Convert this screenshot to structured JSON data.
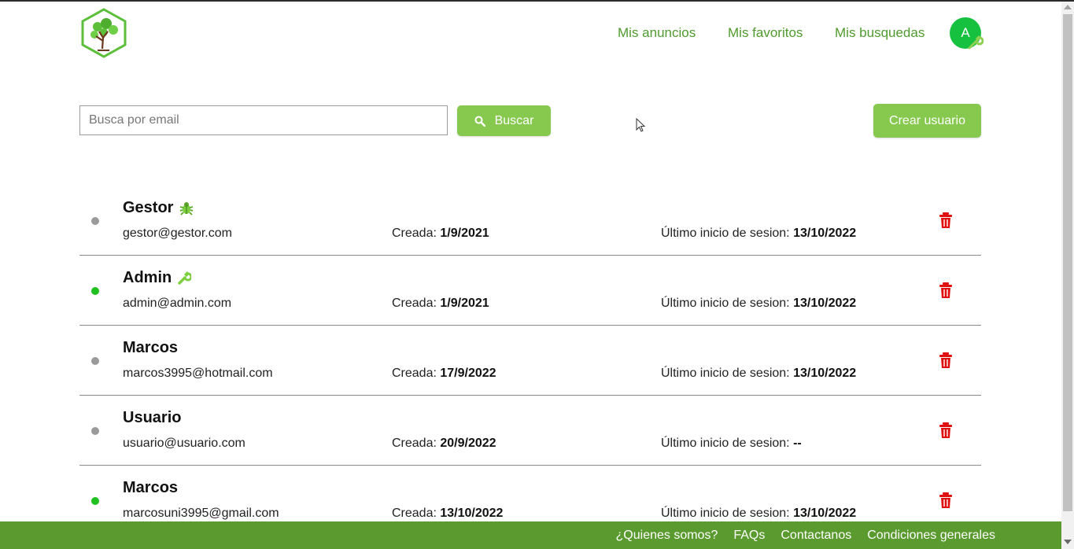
{
  "header": {
    "logo_icon": "tree-hexagon-logo",
    "nav": [
      {
        "label": "Mis anuncios"
      },
      {
        "label": "Mis favoritos"
      },
      {
        "label": "Mis busquedas"
      }
    ],
    "avatar_initial": "A",
    "avatar_badge_icon": "wrench-icon"
  },
  "toolbar": {
    "search_placeholder": "Busca por email",
    "search_value": "",
    "search_button": "Buscar",
    "search_icon": "search-icon",
    "create_button": "Crear usuario"
  },
  "labels": {
    "created": "Creada:",
    "last_login": "Último inicio de sesion:"
  },
  "users": [
    {
      "name": "Gestor",
      "role_icon": "bug-icon",
      "status": "offline",
      "email": "gestor@gestor.com",
      "created": "1/9/2021",
      "last_login": "13/10/2022"
    },
    {
      "name": "Admin",
      "role_icon": "wrench-icon",
      "status": "online",
      "email": "admin@admin.com",
      "created": "1/9/2021",
      "last_login": "13/10/2022"
    },
    {
      "name": "Marcos",
      "role_icon": "",
      "status": "offline",
      "email": "marcos3995@hotmail.com",
      "created": "17/9/2022",
      "last_login": "13/10/2022"
    },
    {
      "name": "Usuario",
      "role_icon": "",
      "status": "offline",
      "email": "usuario@usuario.com",
      "created": "20/9/2022",
      "last_login": "--"
    },
    {
      "name": "Marcos",
      "role_icon": "",
      "status": "online",
      "email": "marcosuni3995@gmail.com",
      "created": "13/10/2022",
      "last_login": "13/10/2022"
    }
  ],
  "footer": {
    "links": [
      "¿Quienes somos?",
      "FAQs",
      "Contactanos",
      "Condiciones generales"
    ]
  },
  "colors": {
    "accent": "#86c94e",
    "nav_text": "#4f9a2e",
    "footer_bg": "#5a9a2e",
    "avatar": "#16c13f",
    "online": "#1fc01f",
    "offline": "#9a9a9a",
    "delete": "#e01010"
  }
}
